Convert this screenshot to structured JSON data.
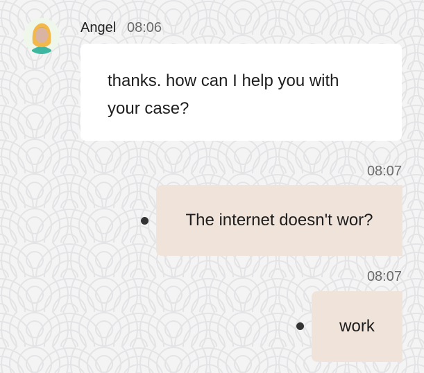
{
  "conversation": {
    "incoming": [
      {
        "sender": "Angel",
        "time": "08:06",
        "text": "thanks. how can I help you with your case?",
        "avatar_icon": "woman-avatar-icon"
      }
    ],
    "outgoing": [
      {
        "time": "08:07",
        "text": "The internet doesn't wor?",
        "status_icon": "sent-dot-icon"
      },
      {
        "time": "08:07",
        "text": "work",
        "status_icon": "sent-dot-icon"
      }
    ]
  },
  "colors": {
    "background": "#f4f4f5",
    "incoming_bubble": "#ffffff",
    "outgoing_bubble": "#f0e3da",
    "avatar_bg": "#eef7e9",
    "hair": "#f2b84b",
    "shirt": "#3fb7a0",
    "status_dot": "#333333"
  }
}
